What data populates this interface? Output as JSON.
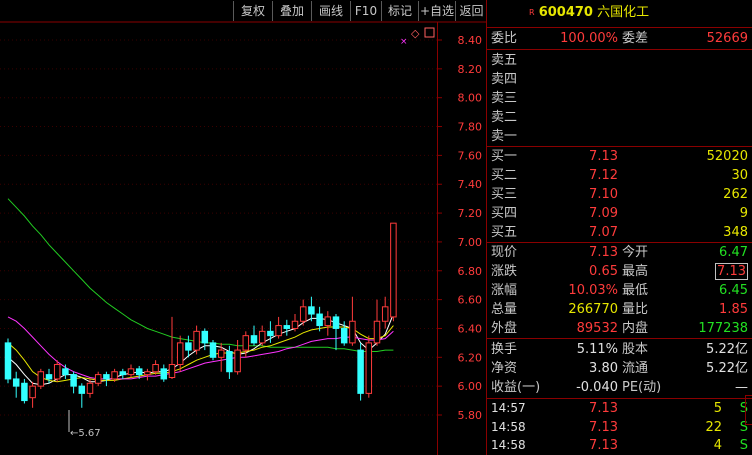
{
  "toolbar": {
    "buttons": [
      "复权",
      "叠加",
      "画线",
      "F10",
      "标记",
      "+自选",
      "返回"
    ]
  },
  "price_axis": [
    "8.40",
    "8.20",
    "8.00",
    "7.80",
    "7.60",
    "7.40",
    "7.20",
    "7.00",
    "6.80",
    "6.60",
    "6.40",
    "6.20",
    "6.00",
    "5.80"
  ],
  "low_marker": "5.67",
  "header": {
    "r_mark": "R",
    "code": "600470",
    "name": "六国化工"
  },
  "weibi": {
    "label": "委比",
    "value": "100.00%",
    "label2": "委差",
    "value2": "52669"
  },
  "sells": [
    {
      "label": "卖五",
      "price": "",
      "vol": ""
    },
    {
      "label": "卖四",
      "price": "",
      "vol": ""
    },
    {
      "label": "卖三",
      "price": "",
      "vol": ""
    },
    {
      "label": "卖二",
      "price": "",
      "vol": ""
    },
    {
      "label": "卖一",
      "price": "",
      "vol": ""
    }
  ],
  "buys": [
    {
      "label": "买一",
      "price": "7.13",
      "vol": "52020"
    },
    {
      "label": "买二",
      "price": "7.12",
      "vol": "30"
    },
    {
      "label": "买三",
      "price": "7.10",
      "vol": "262"
    },
    {
      "label": "买四",
      "price": "7.09",
      "vol": "9"
    },
    {
      "label": "买五",
      "price": "7.07",
      "vol": "348"
    }
  ],
  "quote": [
    {
      "l1": "现价",
      "v1": "7.13",
      "l2": "今开",
      "v2": "6.47"
    },
    {
      "l1": "涨跌",
      "v1": "0.65",
      "l2": "最高",
      "v2": "7.13"
    },
    {
      "l1": "涨幅",
      "v1": "10.03%",
      "l2": "最低",
      "v2": "6.45"
    },
    {
      "l1": "总量",
      "v1": "266770",
      "l2": "量比",
      "v2": "1.85"
    },
    {
      "l1": "外盘",
      "v1": "89532",
      "l2": "内盘",
      "v2": "177238"
    }
  ],
  "fund": [
    {
      "l1": "换手",
      "v1": "5.11%",
      "l2": "股本",
      "v2": "5.22亿"
    },
    {
      "l1": "净资",
      "v1": "3.80",
      "l2": "流通",
      "v2": "5.22亿"
    },
    {
      "l1": "收益(一)",
      "v1": "-0.040",
      "l2": "PE(动)",
      "v2": "—"
    }
  ],
  "ticks": [
    {
      "time": "14:57",
      "price": "7.13",
      "vol": "5",
      "side": "S"
    },
    {
      "time": "14:58",
      "price": "7.13",
      "vol": "22",
      "side": "S"
    },
    {
      "time": "14:58",
      "price": "7.13",
      "vol": "4",
      "side": "S"
    }
  ],
  "chart_data": {
    "type": "candlestick",
    "candles": [
      [
        6.3,
        6.05,
        6.33,
        6.02
      ],
      [
        6.05,
        6.0,
        6.1,
        5.92
      ],
      [
        6.02,
        5.9,
        6.05,
        5.88
      ],
      [
        5.92,
        6.0,
        6.03,
        5.85
      ],
      [
        6.0,
        6.1,
        6.12,
        5.98
      ],
      [
        6.08,
        6.05,
        6.12,
        6.02
      ],
      [
        6.05,
        6.15,
        6.18,
        6.03
      ],
      [
        6.12,
        6.08,
        6.15,
        6.05
      ],
      [
        6.08,
        6.0,
        6.1,
        5.95
      ],
      [
        6.0,
        5.95,
        6.02,
        5.85
      ],
      [
        5.95,
        6.02,
        6.05,
        5.92
      ],
      [
        6.02,
        6.08,
        6.1,
        6.0
      ],
      [
        6.08,
        6.05,
        6.1,
        6.0
      ],
      [
        6.05,
        6.1,
        6.12,
        6.03
      ],
      [
        6.1,
        6.08,
        6.12,
        6.05
      ],
      [
        6.08,
        6.12,
        6.15,
        6.06
      ],
      [
        6.12,
        6.08,
        6.14,
        6.05
      ],
      [
        6.08,
        6.1,
        6.12,
        6.04
      ],
      [
        6.1,
        6.15,
        6.18,
        6.08
      ],
      [
        6.12,
        6.05,
        6.15,
        6.03
      ],
      [
        6.06,
        6.15,
        6.48,
        6.05
      ],
      [
        6.15,
        6.3,
        6.35,
        6.1
      ],
      [
        6.3,
        6.25,
        6.35,
        6.2
      ],
      [
        6.25,
        6.38,
        6.42,
        6.22
      ],
      [
        6.38,
        6.3,
        6.4,
        6.25
      ],
      [
        6.3,
        6.2,
        6.32,
        6.18
      ],
      [
        6.2,
        6.25,
        6.3,
        6.1
      ],
      [
        6.24,
        6.1,
        6.28,
        6.05
      ],
      [
        6.1,
        6.25,
        6.32,
        6.08
      ],
      [
        6.25,
        6.35,
        6.38,
        6.2
      ],
      [
        6.35,
        6.3,
        6.42,
        6.28
      ],
      [
        6.3,
        6.38,
        6.42,
        6.28
      ],
      [
        6.38,
        6.35,
        6.45,
        6.3
      ],
      [
        6.35,
        6.42,
        6.48,
        6.33
      ],
      [
        6.42,
        6.4,
        6.46,
        6.35
      ],
      [
        6.4,
        6.45,
        6.5,
        6.38
      ],
      [
        6.45,
        6.55,
        6.6,
        6.42
      ],
      [
        6.55,
        6.5,
        6.62,
        6.45
      ],
      [
        6.5,
        6.42,
        6.55,
        6.38
      ],
      [
        6.42,
        6.48,
        6.52,
        6.35
      ],
      [
        6.48,
        6.4,
        6.5,
        6.25
      ],
      [
        6.4,
        6.3,
        6.45,
        6.28
      ],
      [
        6.3,
        6.45,
        6.62,
        6.28
      ],
      [
        6.25,
        5.95,
        6.3,
        5.9
      ],
      [
        5.95,
        6.3,
        6.35,
        5.92
      ],
      [
        6.3,
        6.45,
        6.6,
        6.28
      ],
      [
        6.45,
        6.55,
        6.62,
        6.4
      ],
      [
        6.48,
        7.13,
        7.13,
        6.45
      ]
    ],
    "ma_series": [
      {
        "color": "#ffffff",
        "values": [
          6.2,
          6.15,
          6.08,
          6.02,
          6.01,
          6.02,
          6.05,
          6.08,
          6.08,
          6.06,
          6.03,
          6.03,
          6.04,
          6.06,
          6.08,
          6.09,
          6.1,
          6.09,
          6.1,
          6.1,
          6.12,
          6.16,
          6.21,
          6.25,
          6.28,
          6.28,
          6.27,
          6.24,
          6.22,
          6.23,
          6.26,
          6.3,
          6.33,
          6.36,
          6.38,
          6.4,
          6.44,
          6.47,
          6.47,
          6.46,
          6.44,
          6.42,
          6.4,
          6.3,
          6.25,
          6.3,
          6.36,
          6.5
        ]
      },
      {
        "color": "#e6e600",
        "values": [
          6.3,
          6.25,
          6.18,
          6.1,
          6.06,
          6.04,
          6.03,
          6.04,
          6.05,
          6.06,
          6.05,
          6.04,
          6.04,
          6.04,
          6.05,
          6.06,
          6.07,
          6.08,
          6.09,
          6.09,
          6.1,
          6.12,
          6.15,
          6.18,
          6.2,
          6.22,
          6.23,
          6.23,
          6.23,
          6.24,
          6.25,
          6.27,
          6.28,
          6.3,
          6.32,
          6.34,
          6.37,
          6.39,
          6.4,
          6.41,
          6.41,
          6.41,
          6.4,
          6.36,
          6.33,
          6.33,
          6.35,
          6.42
        ]
      },
      {
        "color": "#ff33ff",
        "values": [
          6.48,
          6.45,
          6.4,
          6.34,
          6.28,
          6.22,
          6.17,
          6.13,
          6.1,
          6.08,
          6.06,
          6.05,
          6.05,
          6.05,
          6.05,
          6.05,
          6.06,
          6.07,
          6.07,
          6.08,
          6.09,
          6.1,
          6.12,
          6.14,
          6.16,
          6.17,
          6.18,
          6.19,
          6.2,
          6.2,
          6.21,
          6.22,
          6.23,
          6.24,
          6.26,
          6.27,
          6.29,
          6.31,
          6.32,
          6.33,
          6.33,
          6.34,
          6.34,
          6.33,
          6.32,
          6.32,
          6.33,
          6.38
        ]
      }
    ],
    "ma_long": {
      "color": "#22cc22",
      "values": [
        7.3,
        7.24,
        7.18,
        7.11,
        7.05,
        6.98,
        6.92,
        6.86,
        6.8,
        6.74,
        6.68,
        6.63,
        6.58,
        6.54,
        6.5,
        6.46,
        6.43,
        6.4,
        6.38,
        6.36,
        6.34,
        6.33,
        6.32,
        6.31,
        6.3,
        6.3,
        6.29,
        6.29,
        6.28,
        6.28,
        6.28,
        6.28,
        6.27,
        6.27,
        6.27,
        6.27,
        6.27,
        6.27,
        6.27,
        6.27,
        6.26,
        6.26,
        6.25,
        6.24,
        6.24,
        6.24,
        6.25,
        6.25
      ]
    },
    "ylim": [
      5.6,
      8.5
    ]
  }
}
